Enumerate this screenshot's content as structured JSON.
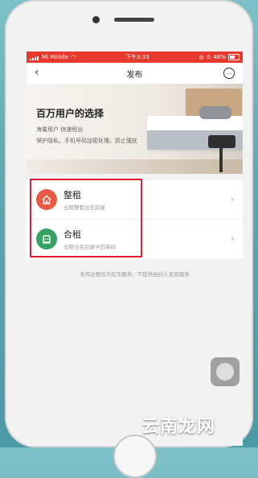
{
  "status_bar": {
    "carrier": "Mi Mobile",
    "time": "下午3:33",
    "battery": "48%"
  },
  "nav": {
    "back_glyph": "‹",
    "title": "发布",
    "more_glyph": "…"
  },
  "banner": {
    "headline": "百万用户的选择",
    "line1": "海量用户    快速租出",
    "line2": "保护隐私，手机号码加密处理，防止骚扰"
  },
  "options": [
    {
      "title": "整租",
      "description": "出租整套住宅房屋",
      "icon": "house-icon",
      "color": "#e95a45"
    },
    {
      "title": "合租",
      "description": "出租住宅房屋中的单间",
      "icon": "bed-icon",
      "color": "#35a262"
    }
  ],
  "footer_note": "发布出租仅为房东服务，不提供经纪人发房服务",
  "watermark": "云南龙网"
}
